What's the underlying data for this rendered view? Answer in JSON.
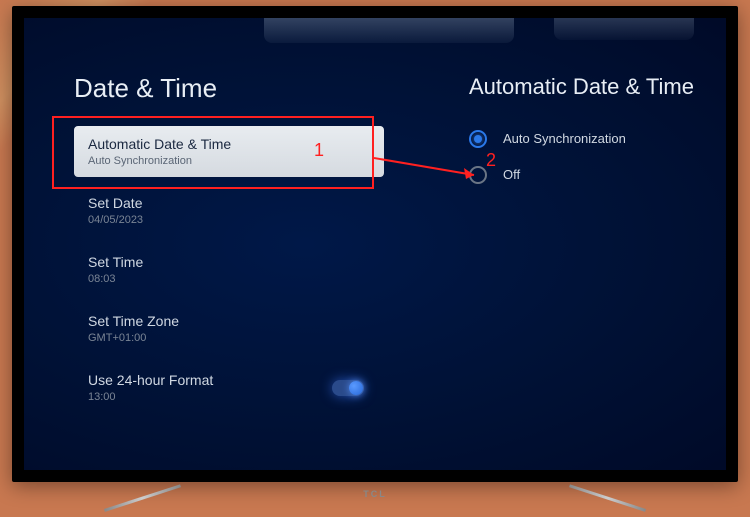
{
  "left": {
    "title": "Date & Time",
    "items": [
      {
        "label": "Automatic Date & Time",
        "value": "Auto Synchronization"
      },
      {
        "label": "Set Date",
        "value": "04/05/2023"
      },
      {
        "label": "Set Time",
        "value": "08:03"
      },
      {
        "label": "Set Time Zone",
        "value": "GMT+01:00"
      },
      {
        "label": "Use 24-hour Format",
        "value": "13:00"
      }
    ]
  },
  "right": {
    "title": "Automatic Date & Time",
    "options": [
      {
        "label": "Auto Synchronization"
      },
      {
        "label": "Off"
      }
    ]
  },
  "annotations": {
    "num1": "1",
    "num2": "2"
  },
  "tv_brand": "TCL"
}
